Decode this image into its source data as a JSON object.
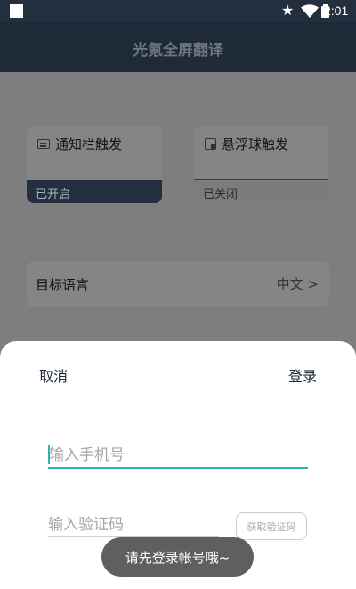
{
  "status_bar": {
    "time": "2:01",
    "icons": [
      "notification-square-icon",
      "star-icon",
      "wifi-icon",
      "battery-icon"
    ]
  },
  "app_bar": {
    "title": "光氪全屏翻译"
  },
  "cards": {
    "notify": {
      "label": "通知栏触发",
      "state": "已开启",
      "icon": "message-icon"
    },
    "float": {
      "label": "悬浮球触发",
      "state": "已关闭",
      "icon": "float-window-icon"
    }
  },
  "language": {
    "label": "目标语言",
    "value": "中文 >"
  },
  "sheet": {
    "cancel_label": "取消",
    "login_label": "登录",
    "phone_placeholder": "输入手机号",
    "code_placeholder": "输入验证码",
    "get_code_label": "获取验证码"
  },
  "toast": {
    "message": "请先登录帐号哦~"
  },
  "colors": {
    "app_bar": "#1f2a38",
    "accent": "#2bb7a6",
    "sheet_bg": "#ffffff"
  }
}
